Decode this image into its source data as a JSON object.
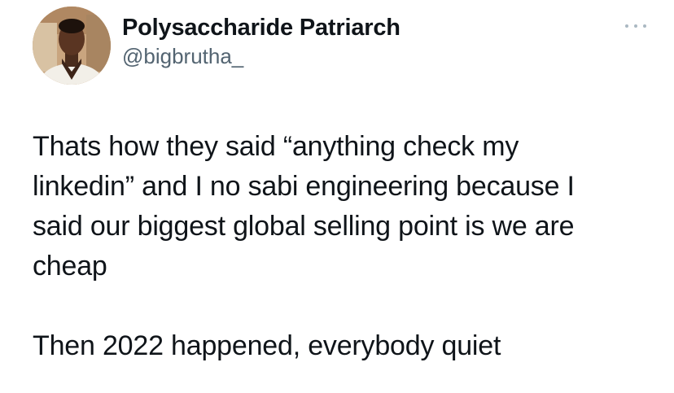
{
  "tweet": {
    "author": {
      "display_name": "Polysaccharide Patriarch",
      "handle": "@bigbrutha_",
      "avatar": "profile-photo"
    },
    "more_icon": "more-options-icon",
    "text": {
      "lines": [
        "Thats how they said “anything check my",
        "linkedin” and I no sabi engineering because I",
        "said our biggest global selling point is we are",
        "cheap"
      ],
      "line_last": "Then 2022 happened, everybody quiet"
    }
  }
}
